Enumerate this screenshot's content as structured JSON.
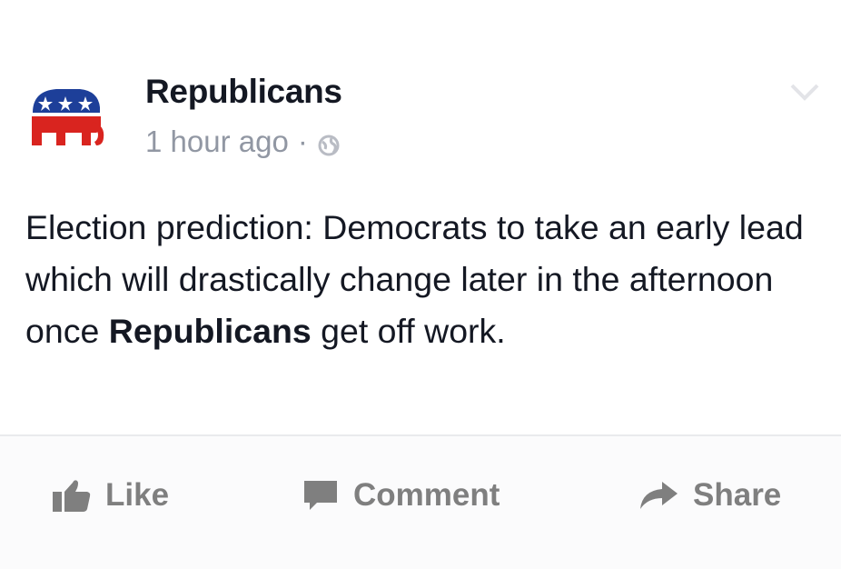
{
  "post": {
    "page_name": "Republicans",
    "timestamp": "1 hour ago",
    "meta_separator": "·",
    "audience_icon": "globe-icon",
    "body_parts": [
      "Election prediction: Democrats to take an early lead which will drastically change later in the afternoon once ",
      "Republicans",
      " get off work."
    ]
  },
  "actions": {
    "like_label": "Like",
    "comment_label": "Comment",
    "share_label": "Share"
  },
  "colors": {
    "logo_blue": "#1d3f99",
    "logo_red": "#d9241f",
    "text_dark": "#141823",
    "text_meta": "#9197a3",
    "action_gray": "#7f7f7f"
  }
}
